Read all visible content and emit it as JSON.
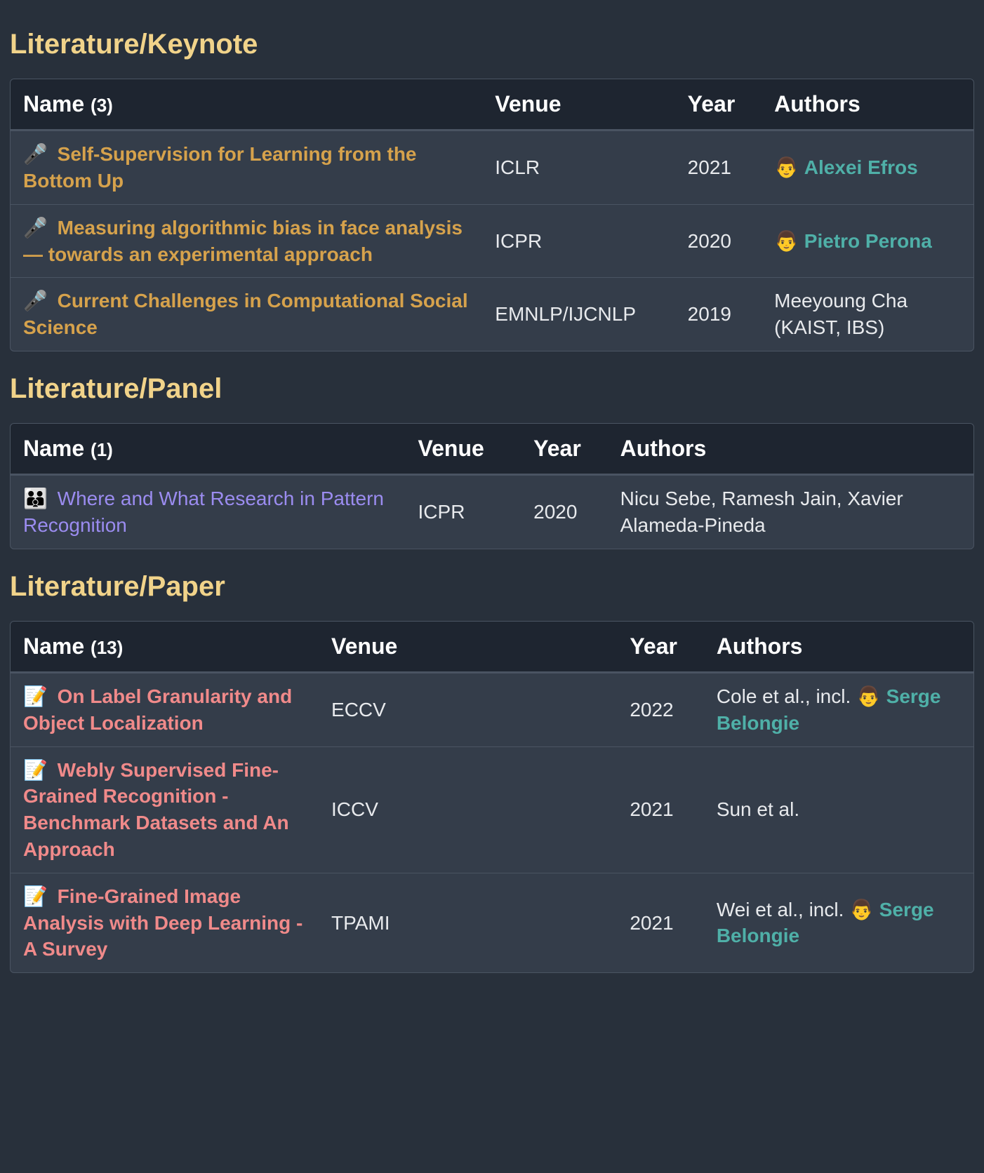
{
  "columns": {
    "name": "Name",
    "venue": "Venue",
    "year": "Year",
    "authors": "Authors"
  },
  "sections": [
    {
      "id": "keynote",
      "title": "Literature/Keynote",
      "count": "(3)",
      "link_class": "link-keynote",
      "rows": [
        {
          "emoji": "🎤",
          "name": "Self-Supervision for Learning from the Bottom Up",
          "venue": "ICLR",
          "year": "2021",
          "authors_prefix": "👨 ",
          "author_link": "Alexei Efros",
          "authors_suffix": ""
        },
        {
          "emoji": "🎤",
          "name": "Measuring algorithmic bias in face analysis — towards an experimental approach",
          "venue": "ICPR",
          "year": "2020",
          "authors_prefix": "👨 ",
          "author_link": "Pietro Perona",
          "authors_suffix": ""
        },
        {
          "emoji": "🎤",
          "name": "Current Challenges in Computational Social Science",
          "venue": "EMNLP/IJCNLP",
          "year": "2019",
          "authors_prefix": "Meeyoung Cha (KAIST, IBS)",
          "author_link": "",
          "authors_suffix": ""
        }
      ]
    },
    {
      "id": "panel",
      "title": "Literature/Panel",
      "count": "(1)",
      "link_class": "link-panel",
      "rows": [
        {
          "emoji": "👪",
          "name": "Where and What Research in Pattern Recognition",
          "venue": "ICPR",
          "year": "2020",
          "authors_prefix": "Nicu Sebe, Ramesh Jain, Xavier Alameda-Pineda",
          "author_link": "",
          "authors_suffix": ""
        }
      ]
    },
    {
      "id": "paper",
      "title": "Literature/Paper",
      "count": "(13)",
      "link_class": "link-paper",
      "rows": [
        {
          "emoji": "📝",
          "name": "On Label Granularity and Object Localization",
          "venue": "ECCV",
          "year": "2022",
          "authors_prefix": "Cole et al., incl. 👨 ",
          "author_link": "Serge Belongie",
          "authors_suffix": ""
        },
        {
          "emoji": "📝",
          "name": "Webly Supervised Fine-Grained Recognition - Benchmark Datasets and An Approach",
          "venue": "ICCV",
          "year": "2021",
          "authors_prefix": "Sun et al.",
          "author_link": "",
          "authors_suffix": ""
        },
        {
          "emoji": "📝",
          "name": "Fine-Grained Image Analysis with Deep Learning - A Survey",
          "venue": "TPAMI",
          "year": "2021",
          "authors_prefix": "Wei et al., incl. 👨 ",
          "author_link": "Serge Belongie",
          "authors_suffix": ""
        }
      ]
    }
  ],
  "col_widths": {
    "keynote": [
      "49%",
      "20%",
      "9%",
      "22%"
    ],
    "panel": [
      "41%",
      "12%",
      "9%",
      "38%"
    ],
    "paper": [
      "32%",
      "31%",
      "9%",
      "28%"
    ]
  }
}
